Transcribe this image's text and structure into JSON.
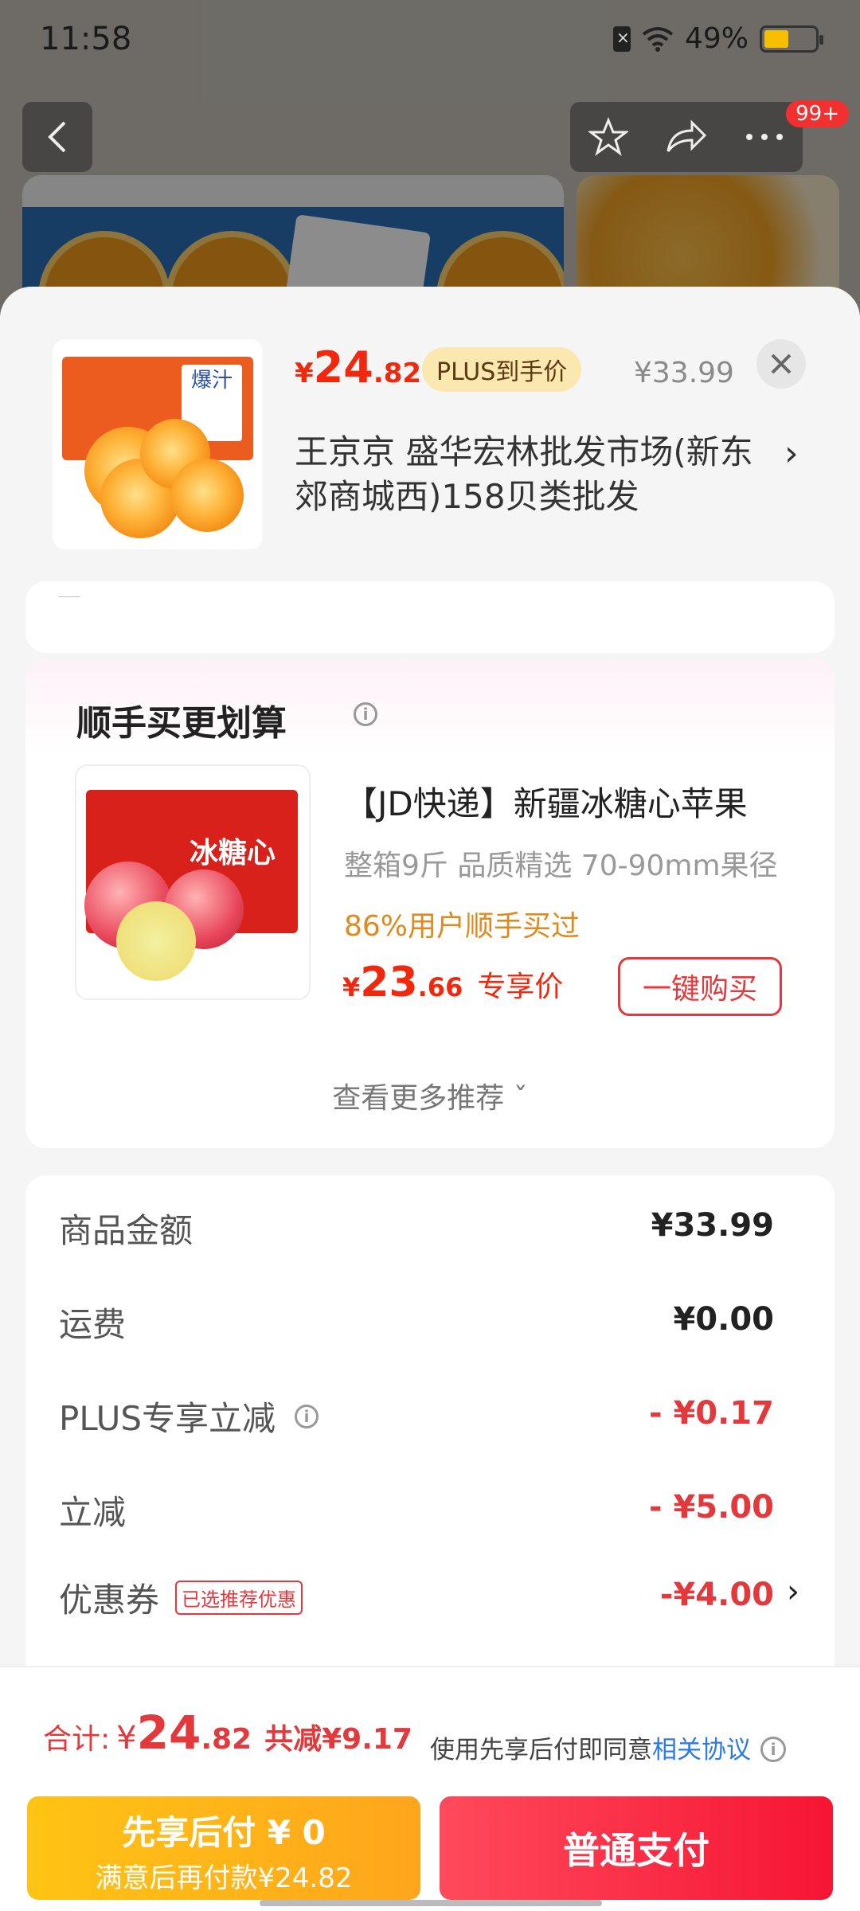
{
  "status_bar": {
    "time": "11:58",
    "battery": "49%",
    "battery_level": 0.49
  },
  "background": {
    "back_icon": "chevron-left-icon",
    "favorite_icon": "star-icon",
    "share_icon": "share-icon",
    "more_icon": "more-icon",
    "badge": "99+"
  },
  "header": {
    "price_currency": "¥",
    "price_int": "24",
    "price_dec": ".82",
    "plus_tag": "PLUS到手价",
    "original_price": "¥33.99",
    "close_icon": "close-icon",
    "address": "王京京  盛华宏林批发市场(新东郊商城西)158贝类批发"
  },
  "recommend": {
    "title": "顺手买更划算",
    "product_name": "【JD快递】新疆冰糖心苹果",
    "product_desc": "整箱9斤 品质精选 70-90mm果径",
    "box_label": "冰糖心",
    "social_proof": "86%用户顺手买过",
    "price_currency": "¥",
    "price_int": "23",
    "price_dec": ".66",
    "price_label": "专享价",
    "buy_button": "一键购买",
    "more_link": "查看更多推荐 ˇ"
  },
  "amounts": {
    "rows": [
      {
        "label": "商品金额",
        "value": "¥33.99"
      },
      {
        "label": "运费",
        "value": "¥0.00"
      },
      {
        "label": "PLUS专享立减",
        "value": "- ¥0.17"
      },
      {
        "label": "立减",
        "value": "- ¥5.00"
      },
      {
        "label": "优惠券",
        "tag": "已选推荐优惠",
        "value": "-¥4.00"
      }
    ]
  },
  "footer": {
    "total_label": "合计:",
    "total_currency": "¥",
    "total_int": "24",
    "total_dec": ".82",
    "total_saved": "共减¥9.17",
    "agree_text": "使用先享后付即同意",
    "agree_link": "相关协议",
    "pay_later_line1": "先享后付 ¥ 0",
    "pay_later_line2": "满意后再付款¥24.82",
    "pay_normal": "普通支付"
  },
  "colors": {
    "accent_red": "#e4393c",
    "price_red": "#f2270c",
    "pay_later_yellow": "#ffb31a",
    "link_blue": "#2c7be5"
  }
}
